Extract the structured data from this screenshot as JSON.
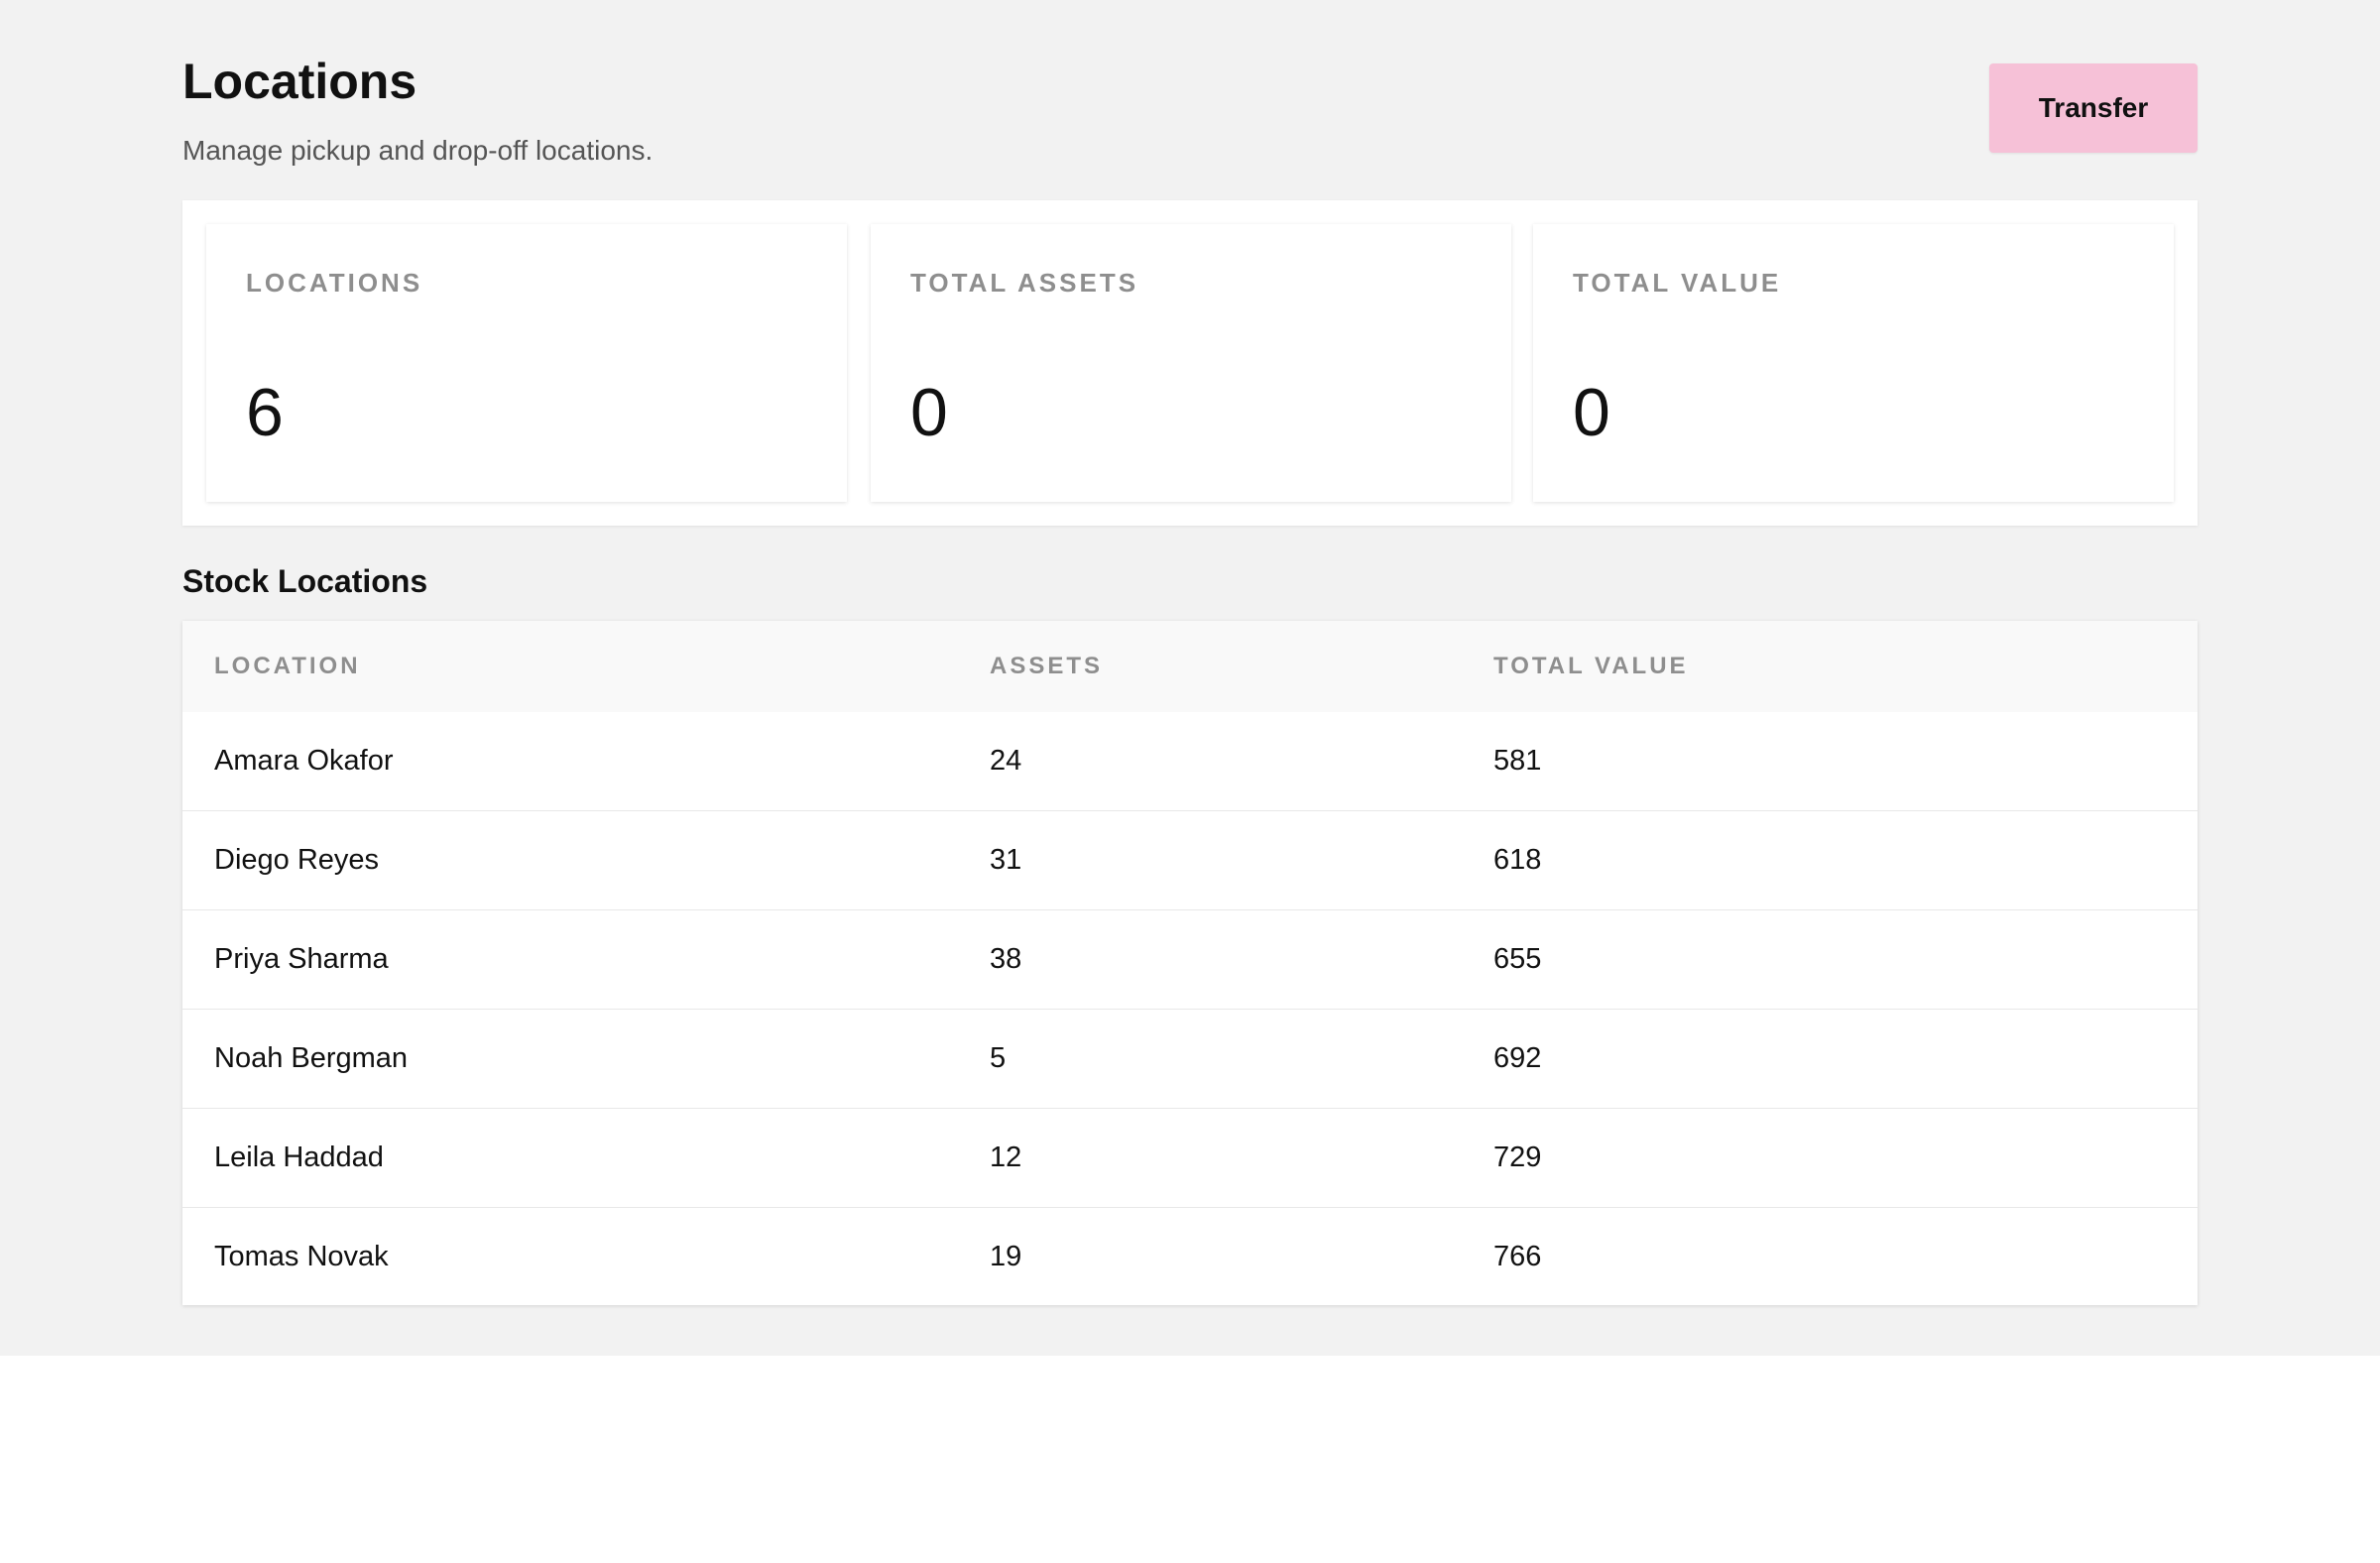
{
  "header": {
    "title": "Locations",
    "subtitle": "Manage pickup and drop-off locations.",
    "transfer_label": "Transfer"
  },
  "stats": [
    {
      "label": "LOCATIONS",
      "value": "6"
    },
    {
      "label": "TOTAL ASSETS",
      "value": "0"
    },
    {
      "label": "TOTAL VALUE",
      "value": "0"
    }
  ],
  "section": {
    "title": "Stock Locations"
  },
  "table": {
    "columns": [
      "LOCATION",
      "ASSETS",
      "TOTAL VALUE"
    ],
    "rows": [
      {
        "location": "Amara Okafor",
        "assets": "24",
        "value": "581"
      },
      {
        "location": "Diego Reyes",
        "assets": "31",
        "value": "618"
      },
      {
        "location": "Priya Sharma",
        "assets": "38",
        "value": "655"
      },
      {
        "location": "Noah Bergman",
        "assets": "5",
        "value": "692"
      },
      {
        "location": "Leila Haddad",
        "assets": "12",
        "value": "729"
      },
      {
        "location": "Tomas Novak",
        "assets": "19",
        "value": "766"
      }
    ]
  },
  "colors": {
    "background": "#f2f2f2",
    "accent_button": "#f6c1d7",
    "muted_text": "#8e8e8e"
  }
}
